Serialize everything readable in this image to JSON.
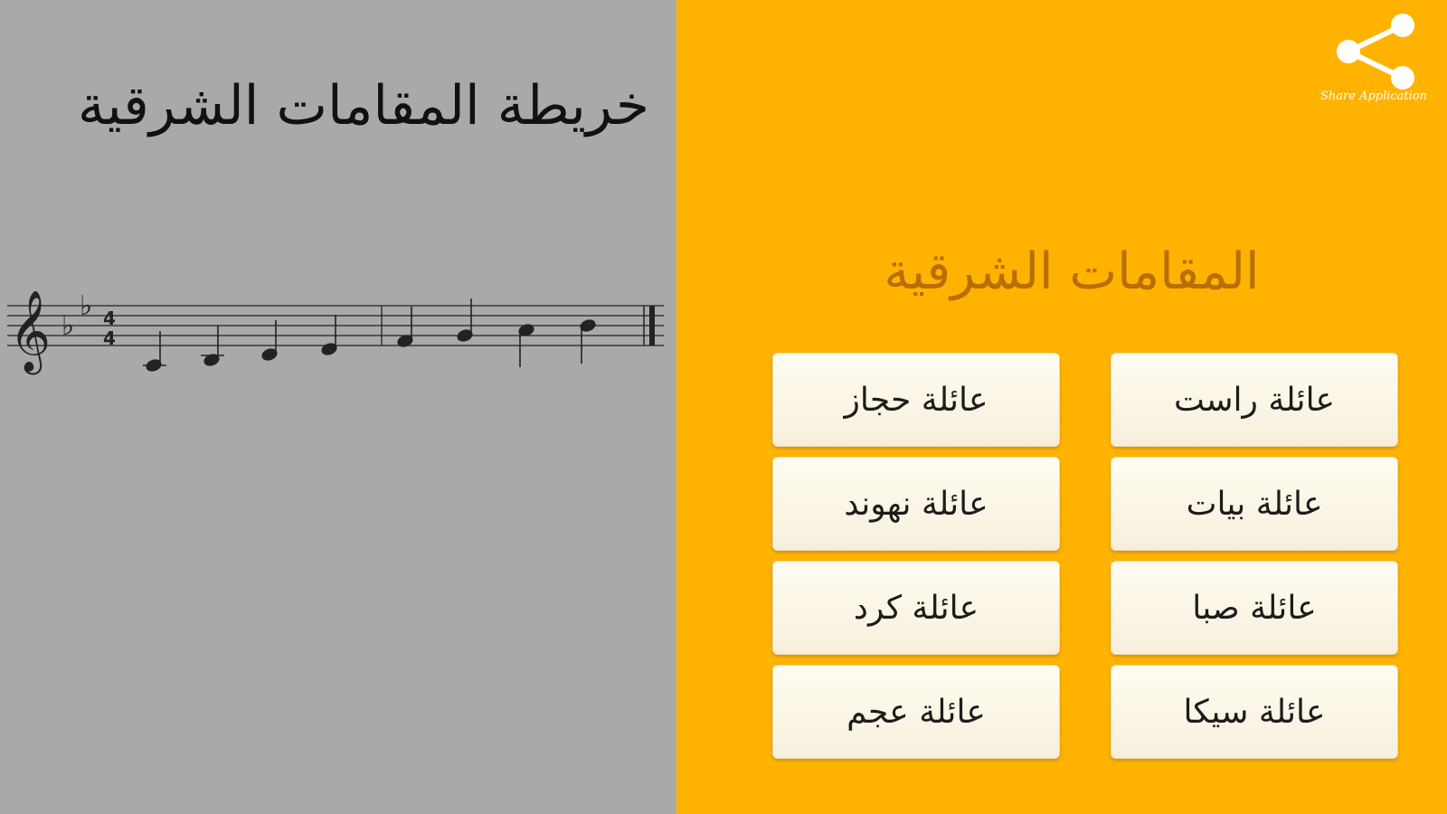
{
  "left": {
    "title": "خريطة المقامات الشرقية",
    "music": {
      "clef": "treble",
      "key_signature": [
        "flat",
        "flat"
      ],
      "time_signature": "4/4"
    }
  },
  "right": {
    "share": {
      "caption": "Share Application",
      "icon": "share-icon"
    },
    "section_title": "المقامات الشرقية",
    "families": [
      {
        "label": "عائلة راست"
      },
      {
        "label": "عائلة حجاز"
      },
      {
        "label": "عائلة بيات"
      },
      {
        "label": "عائلة نهوند"
      },
      {
        "label": "عائلة صبا"
      },
      {
        "label": "عائلة كرد"
      },
      {
        "label": "عائلة سيكا"
      },
      {
        "label": "عائلة عجم"
      }
    ]
  },
  "colors": {
    "left_background": "#a9a9a9",
    "right_background": "#ffb300",
    "section_title": "#b86e00",
    "button_face": "#fffdf2"
  }
}
